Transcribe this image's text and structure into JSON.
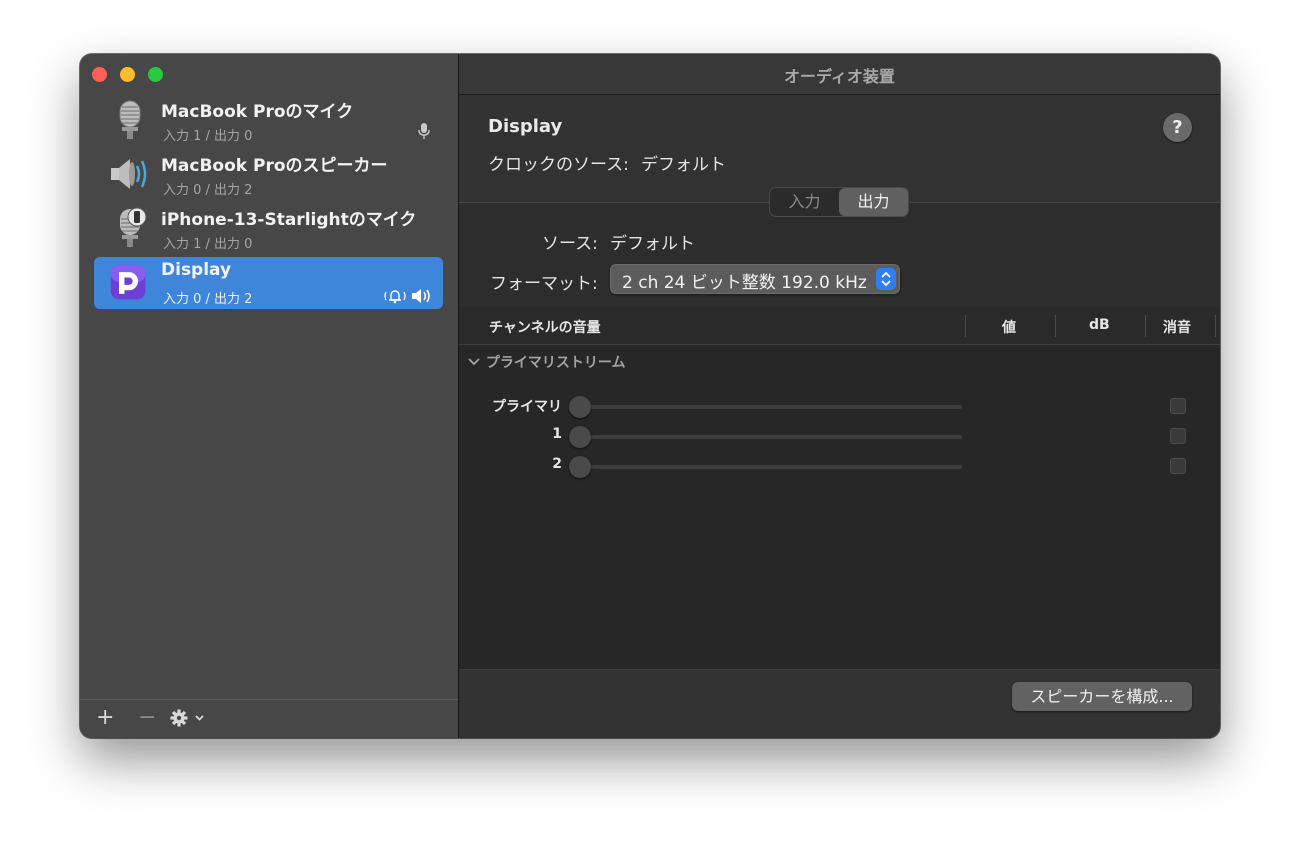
{
  "window": {
    "title": "オーディオ装置"
  },
  "sidebar": {
    "devices": [
      {
        "name": "MacBook Proのマイク",
        "subtitle": "入力 1 / 出力 0",
        "icon": "microphone-icon"
      },
      {
        "name": "MacBook Proのスピーカー",
        "subtitle": "入力 0 / 出力 2",
        "icon": "speaker-icon"
      },
      {
        "name": "iPhone-13-Starlightのマイク",
        "subtitle": "入力 1 / 出力 0",
        "icon": "iphone-microphone-icon"
      },
      {
        "name": "Display",
        "subtitle": "入力 0 / 出力 2",
        "icon": "display-app-icon",
        "selected": true
      }
    ],
    "toolbar": {
      "add": "+",
      "remove": "−"
    }
  },
  "detail": {
    "device_title": "Display",
    "help": "?",
    "clock_label": "クロックのソース:",
    "clock_value": "デフォルト",
    "tabs": [
      "入力",
      "出力"
    ],
    "active_tab": "出力",
    "source_label": "ソース:",
    "source_value": "デフォルト",
    "format_label": "フォーマット:",
    "format_value": "2 ch 24 ビット整数 192.0 kHz"
  },
  "table": {
    "headers": [
      "チャンネルの音量",
      "値",
      "dB",
      "消音"
    ],
    "group": "プライマリストリーム",
    "channels": [
      {
        "label": "プライマリ",
        "level": 0,
        "muted": false
      },
      {
        "label": "1",
        "level": 0,
        "muted": false
      },
      {
        "label": "2",
        "level": 0,
        "muted": false
      }
    ]
  },
  "footer": {
    "configure_button": "スピーカーを構成..."
  },
  "colors": {
    "accent": "#3f86db",
    "select_arrows": "#2f7ef4"
  }
}
